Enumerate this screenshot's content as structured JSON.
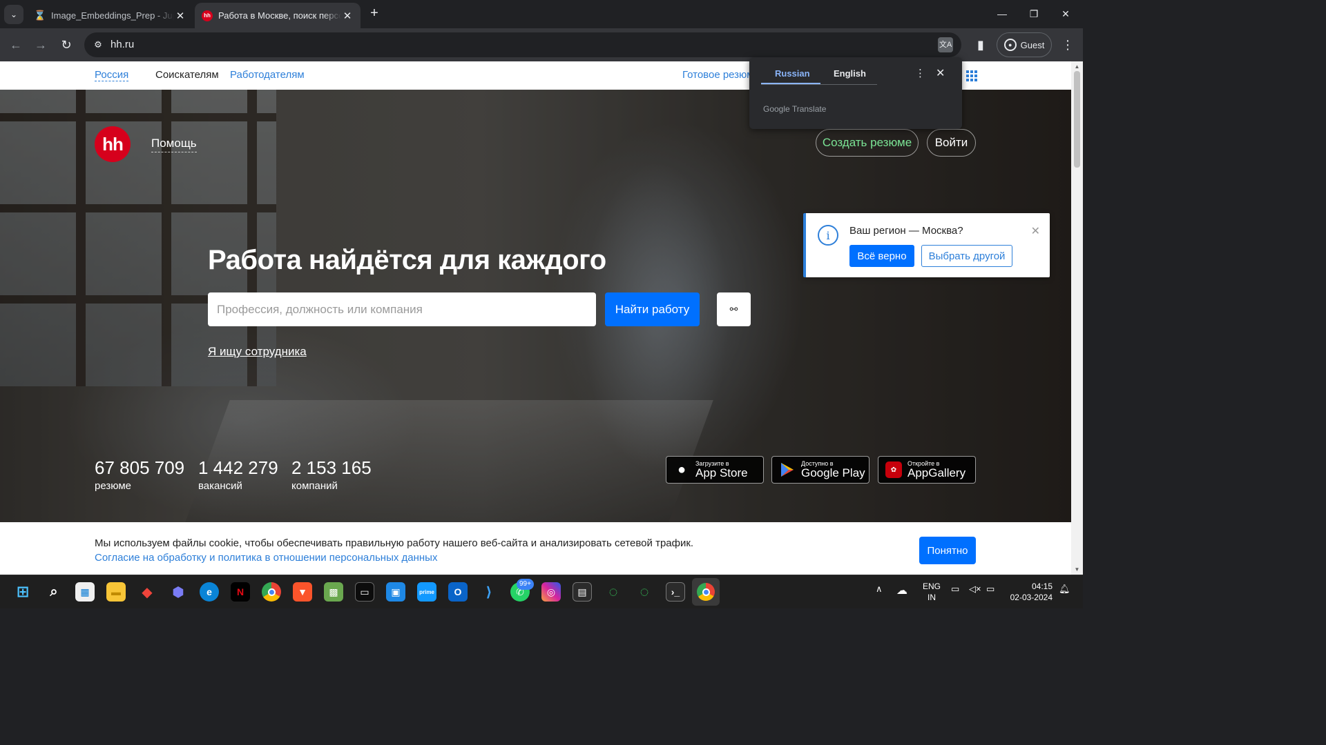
{
  "browser": {
    "tabs": [
      {
        "title": "Image_Embeddings_Prep - Jupyter",
        "icon": "hourglass-icon"
      },
      {
        "title": "Работа в Москве, поиск персонала",
        "icon": "hh-favicon"
      }
    ],
    "new_tab": "+",
    "url": "hh.ru",
    "profile": "Guest"
  },
  "translate_popup": {
    "source_lang": "Russian",
    "target_lang": "English",
    "brand": "Google Translate"
  },
  "site": {
    "top_nav": {
      "region": "Россия",
      "seekers": "Соискателям",
      "employers": "Работодателям",
      "ready_resumes": "Готовое резюме"
    },
    "logo_text": "hh",
    "help": "Помощь",
    "create_resume": "Создать резюме",
    "login": "Войти",
    "headline": "Работа найдётся для каждого",
    "search": {
      "placeholder": "Профессия, должность или компания",
      "value": "",
      "button": "Найти работу"
    },
    "employer_link": "Я ищу сотрудника",
    "stats": [
      {
        "value": "67 805 709",
        "label": "резюме"
      },
      {
        "value": "1 442 279",
        "label": "вакансий"
      },
      {
        "value": "2 153 165",
        "label": "компаний"
      }
    ],
    "stores": [
      {
        "small": "Загрузите в",
        "big": "App Store",
        "icon": "apple-icon"
      },
      {
        "small": "Доступно в",
        "big": "Google Play",
        "icon": "google-play-icon"
      },
      {
        "small": "Откройте в",
        "big": "AppGallery",
        "icon": "huawei-icon"
      }
    ],
    "region_popup": {
      "question": "Ваш регион — Москва?",
      "confirm": "Всё верно",
      "choose_other": "Выбрать другой"
    },
    "cookie": {
      "text": "Мы используем файлы cookie, чтобы обеспечивать правильную работу нашего веб-сайта и анализировать сетевой трафик.",
      "link": "Согласие на обработку и политика в отношении персональных данных",
      "button": "Понятно"
    }
  },
  "taskbar": {
    "apps": [
      "start-icon",
      "search-icon",
      "store-icon",
      "file-explorer-icon",
      "anydesk-icon",
      "copilot-icon",
      "edge-icon",
      "netflix-icon",
      "chrome-icon",
      "brave-icon",
      "minecraft-icon",
      "terminal-icon",
      "window-icon",
      "prime-video-icon",
      "outlook-icon",
      "vscode-icon",
      "whatsapp-icon",
      "instagram-icon",
      "console-icon",
      "spinner-icon",
      "spinner-icon-2",
      "terminal-2-icon",
      "chrome-active-icon"
    ],
    "whatsapp_badge": "99+",
    "lang_top": "ENG",
    "lang_bottom": "IN",
    "time": "04:15",
    "date": "02-03-2024"
  },
  "colors": {
    "brand_red": "#d6001c",
    "primary_blue": "#0070ff",
    "link_blue": "#2d7fd9",
    "resume_green": "#7be495"
  }
}
